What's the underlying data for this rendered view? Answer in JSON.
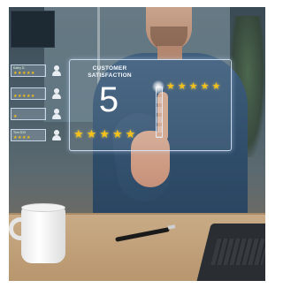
{
  "overlay": {
    "title": "CUSTOMER SATISFACTION",
    "score": "5",
    "top_stars": [
      "★",
      "★",
      "★",
      "★",
      "★"
    ],
    "bottom_stars": [
      "★",
      "★",
      "★",
      "★",
      "★"
    ]
  },
  "reviews": [
    {
      "name": "Kathy D.",
      "stars": "★★★★★"
    },
    {
      "name": "",
      "stars": "★★★★★"
    },
    {
      "name": "",
      "stars": "★"
    },
    {
      "name": "Tom D23",
      "stars": "★★★★"
    }
  ],
  "colors": {
    "star": "#f4c21a",
    "hologram": "#e6f0ff"
  }
}
